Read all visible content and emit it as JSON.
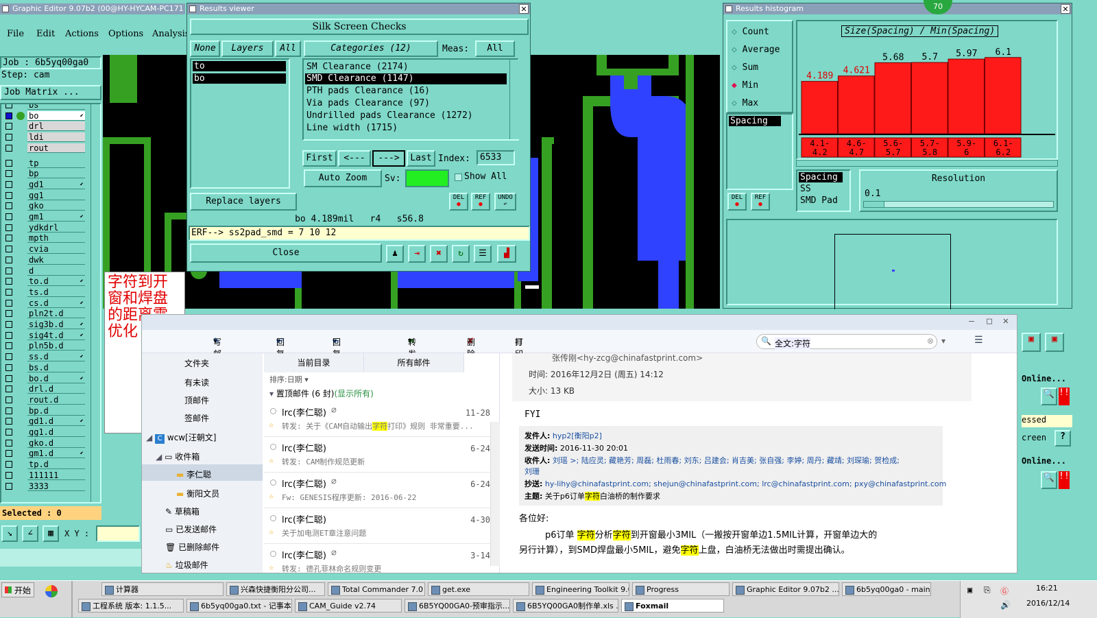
{
  "editor": {
    "title": "Graphic Editor 9.07b2 (00@HY-HYCAM-PC171",
    "menu": [
      "File",
      "Edit",
      "Actions",
      "Options",
      "Analysis"
    ],
    "job": "Job : 6b5yq00ga0",
    "step": "Step: cam",
    "job_matrix": "Job Matrix ...",
    "layers": [
      "bs",
      "bo",
      "drl",
      "ldi",
      "rout",
      "tp",
      "bp",
      "gd1",
      "gg1",
      "gko",
      "gm1",
      "ydkdrl",
      "mpth",
      "cvia",
      "dwk",
      "d",
      "to.d",
      "ts.d",
      "cs.d",
      "pln2t.d",
      "sig3b.d",
      "sig4t.d",
      "pln5b.d",
      "ss.d",
      "bs.d",
      "bo.d",
      "drl.d",
      "rout.d",
      "bp.d",
      "gd1.d",
      "gg1.d",
      "gko.d",
      "gm1.d",
      "tp.d",
      "111111",
      "3333"
    ],
    "selected": "Selected : 0",
    "xy_label": "X Y :",
    "annotation": "字符到开窗和焊盘的距离需优化"
  },
  "viewer": {
    "title": "Results viewer",
    "header": "Silk Screen Checks",
    "tabs": [
      "None",
      "Layers",
      "All"
    ],
    "layer_items": [
      "to",
      "bo"
    ],
    "categories_label": "Categories (12)",
    "meas_label": "Meas:",
    "meas_value": "All",
    "categories": [
      "SM Clearance (2174)",
      "SMD Clearance (1147)",
      "PTH pads Clearance (16)",
      "Via pads Clearance (97)",
      "Undrilled pads Clearance (1272)",
      "Line width (1715)"
    ],
    "nav": [
      "First",
      "<---",
      "--->",
      "Last"
    ],
    "index_label": "Index:",
    "index_value": "6533",
    "auto_zoom": "Auto Zoom",
    "sv_label": "Sv:",
    "show_all": "Show All",
    "replace_layers": "Replace layers",
    "del": "DEL",
    "ref": "REF",
    "undo": "UNDO",
    "status1": "bo 4.189mil   r4   s56.8",
    "status2": "ERF--> ss2pad_smd = 7 10 12",
    "close": "Close"
  },
  "histogram": {
    "title": "Results histogram",
    "badge": "70",
    "options": [
      "Count",
      "Average",
      "Sum",
      "Min",
      "Max"
    ],
    "list_items": [
      "Spacing"
    ],
    "chart_title": "Size(Spacing) / Min(Spacing)",
    "stat_items": [
      "Spacing",
      "SS",
      "SMD Pad"
    ],
    "resolution_label": "Resolution",
    "resolution_value": "0.1",
    "del": "DEL",
    "ref": "REF"
  },
  "chart_data": {
    "type": "bar",
    "title": "Size(Spacing) / Min(Spacing)",
    "categories": [
      "4.1-4.2",
      "4.6-4.7",
      "5.6-5.7",
      "5.7-5.8",
      "5.9-6",
      "6.1-6.2"
    ],
    "values": [
      4.189,
      4.621,
      5.68,
      5.7,
      5.97,
      6.1
    ],
    "value_labels": [
      "4.189",
      "4.621",
      "5.68",
      "5.7",
      "5.97",
      "6.1"
    ],
    "ylim": [
      0,
      6.8
    ]
  },
  "right_strip": {
    "online1": "Online...",
    "pressed": "essed",
    "screen": "creen",
    "online2": "Online..."
  },
  "mail": {
    "toolbar": [
      "写邮件",
      "回复",
      "回复全部",
      "转发",
      "删除",
      "打印预览"
    ],
    "search_value": "全文:字符",
    "folders_top": [
      "文件夹",
      "有未读",
      "顶邮件",
      "签邮件"
    ],
    "account": "wcw[汪朝文]",
    "inbox": "收件箱",
    "sub_folders": [
      "李仁聪",
      "衡阳文员"
    ],
    "other_folders": [
      "草稿箱",
      "已发送邮件",
      "已删除邮件",
      "垃圾邮件"
    ],
    "list_tabs": [
      "当前目录",
      "所有邮件"
    ],
    "sort": "排序:日期",
    "pinned": "置顶邮件 (6 封)",
    "pinned_show": "(显示所有)",
    "messages": [
      {
        "from": "lrc(李仁聪)",
        "date": "11-28",
        "subject_pre": "转发: 关于《CAM自动输出",
        "subject_hl": "字符",
        "subject_post": "打印》规则 非常重要..."
      },
      {
        "from": "lrc(李仁聪)",
        "date": "6-24",
        "subject_pre": "转发: CAM制作规范更新",
        "subject_hl": "",
        "subject_post": ""
      },
      {
        "from": "lrc(李仁聪)",
        "date": "6-24",
        "subject_pre": "Fw: GENESIS程序更新: 2016-06-22",
        "subject_hl": "",
        "subject_post": ""
      },
      {
        "from": "lrc(李仁聪)",
        "date": "4-30",
        "subject_pre": "关于加电测ET章注意问题",
        "subject_hl": "",
        "subject_post": ""
      },
      {
        "from": "lrc(李仁聪)",
        "date": "3-14",
        "subject_pre": "转发: 德孔菲林命名规则变更",
        "subject_hl": "",
        "subject_post": ""
      }
    ],
    "reading": {
      "sender": "张传刚<hy-zcg@chinafastprint.com>",
      "time": "时间: 2016年12月2日 (周五) 14:12",
      "size": "大小: 13 KB",
      "fyi": "FYI",
      "from_label": "发件人:",
      "from_value": "hyp2[衡阳p2]",
      "sent_label": "发送时间:",
      "sent_value": "2016-11-30 20:01",
      "to_label": "收件人:",
      "to_value": "刘瑶 >; 陆应灵; 藏艳芳; 周磊; 杜雨春; 刘东; 吕建会; 肖吉美; 张自强; 李婷; 周丹; 藏靖; 刘琛瑜; 贺检成;",
      "to_value2": "刘珊",
      "cc_label": "抄送:",
      "cc_value": "hy-lihy@chinafastprint.com; shejun@chinafastprint.com; lrc@chinafastprint.com; pxy@chinafastprint.com",
      "subj_label": "主题:",
      "subj_pre": "关于p6订单",
      "subj_hl": "字符",
      "subj_post": "白油桥的制作要求",
      "greeting": "各位好:",
      "body1_a": "p6订单 ",
      "body1_hl1": "字符",
      "body1_b": "分析",
      "body1_hl2": "字符",
      "body1_c": "到开窗最小3MIL（一搬按开窗单边1.5MIL计算，开窗单边大的",
      "body2_a": "另行计算），到SMD焊盘最小5MIL，避免",
      "body2_hl": "字符",
      "body2_b": "上盘，白油桥无法做出时需提出确认。"
    }
  },
  "taskbar": {
    "start": "开始",
    "row1": [
      "计算器",
      "兴森快捷衡阳分公司...",
      "Total Commander 7.0 ...",
      "get.exe",
      "Engineering Toolkit 9.0...",
      "Progress",
      "Graphic Editor 9.07b2 ...",
      "6b5yq00ga0 - main_qa"
    ],
    "row2": [
      "工程系统 版本: 1.1.5...",
      "6b5yq00ga0.txt - 记事本",
      "CAM_Guide v2.74",
      "6B5YQ00GA0-预审指示...",
      "6B5YQ00GA0制作单.xls ...",
      "Foxmail"
    ],
    "time": "16:21",
    "date": "2016/12/14"
  }
}
